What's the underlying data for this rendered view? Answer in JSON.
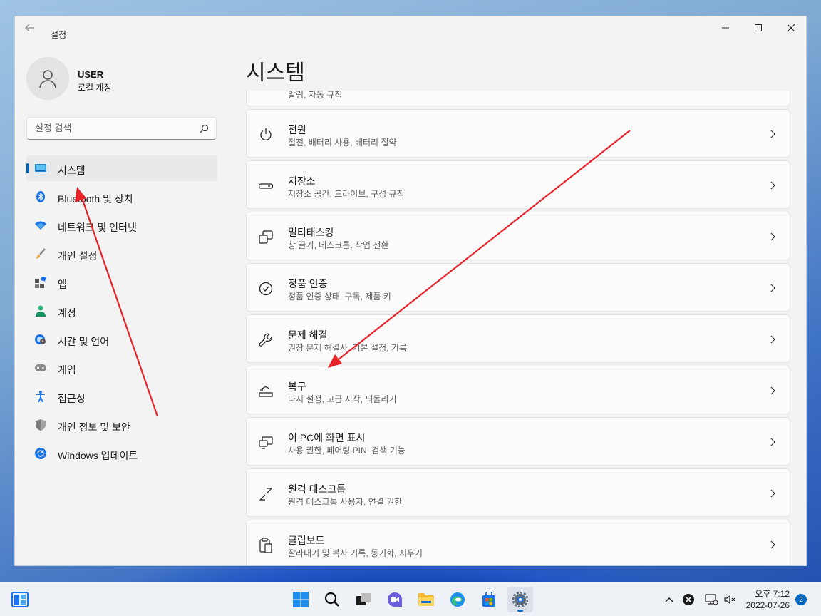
{
  "window": {
    "title": "설정"
  },
  "user": {
    "name": "USER",
    "account_type": "로컬 계정"
  },
  "search": {
    "placeholder": "설정 검색"
  },
  "sidebar": {
    "items": [
      {
        "label": "시스템",
        "icon": "monitor-icon",
        "active": true
      },
      {
        "label": "Bluetooth 및 장치",
        "icon": "bluetooth-icon"
      },
      {
        "label": "네트워크 및 인터넷",
        "icon": "wifi-icon"
      },
      {
        "label": "개인 설정",
        "icon": "brush-icon"
      },
      {
        "label": "앱",
        "icon": "apps-icon"
      },
      {
        "label": "계정",
        "icon": "person-icon"
      },
      {
        "label": "시간 및 언어",
        "icon": "globe-clock-icon"
      },
      {
        "label": "게임",
        "icon": "gamepad-icon"
      },
      {
        "label": "접근성",
        "icon": "accessibility-icon"
      },
      {
        "label": "개인 정보 및 보안",
        "icon": "shield-icon"
      },
      {
        "label": "Windows 업데이트",
        "icon": "update-icon"
      }
    ]
  },
  "main": {
    "title": "시스템",
    "partial_item_desc": "알림, 자동 규칙",
    "items": [
      {
        "title": "전원",
        "desc": "절전, 배터리 사용, 배터리 절약",
        "icon": "power-icon"
      },
      {
        "title": "저장소",
        "desc": "저장소 공간, 드라이브, 구성 규칙",
        "icon": "storage-icon"
      },
      {
        "title": "멀티태스킹",
        "desc": "창 끌기, 데스크톱, 작업 전환",
        "icon": "multitasking-icon"
      },
      {
        "title": "정품 인증",
        "desc": "정품 인증 상태, 구독, 제품 키",
        "icon": "activation-check-icon"
      },
      {
        "title": "문제 해결",
        "desc": "권장 문제 해결사, 기본 설정, 기록",
        "icon": "wrench-icon"
      },
      {
        "title": "복구",
        "desc": "다시 설정, 고급 시작, 되돌리기",
        "icon": "recovery-icon"
      },
      {
        "title": "이 PC에 화면 표시",
        "desc": "사용 권한, 페어링 PIN, 검색 기능",
        "icon": "project-to-pc-icon"
      },
      {
        "title": "원격 데스크톱",
        "desc": "원격 데스크톱 사용자, 연결 권한",
        "icon": "remote-desktop-icon"
      },
      {
        "title": "클립보드",
        "desc": "잘라내기 및 복사 기록, 동기화, 지우기",
        "icon": "clipboard-icon"
      }
    ]
  },
  "taskbar": {
    "clock_period_time": "오후 7:12",
    "date": "2022-07-26",
    "notification_count": "2"
  },
  "colors": {
    "accent": "#0067c0",
    "annotation_arrow": "#e8232a"
  }
}
